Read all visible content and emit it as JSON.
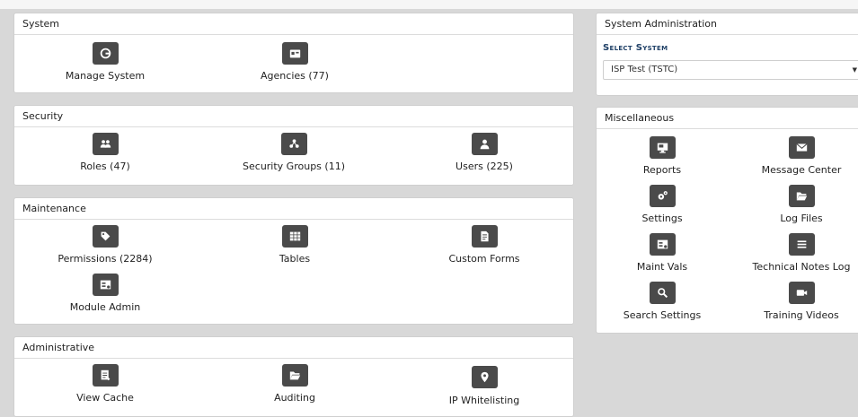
{
  "system": {
    "title": "System",
    "items": [
      {
        "label": "Manage System",
        "icon": "manage-system-icon"
      },
      {
        "label": "Agencies (77)",
        "icon": "agencies-icon"
      }
    ]
  },
  "security": {
    "title": "Security",
    "items": [
      {
        "label": "Roles (47)",
        "icon": "roles-icon"
      },
      {
        "label": "Security Groups (11)",
        "icon": "security-groups-icon"
      },
      {
        "label": "Users (225)",
        "icon": "user-icon"
      }
    ]
  },
  "maintenance": {
    "title": "Maintenance",
    "items": [
      {
        "label": "Permissions (2284)",
        "icon": "permissions-icon"
      },
      {
        "label": "Tables",
        "icon": "table-icon"
      },
      {
        "label": "Custom Forms",
        "icon": "custom-forms-icon"
      },
      {
        "label": "Module Admin",
        "icon": "module-admin-icon"
      }
    ]
  },
  "administrative": {
    "title": "Administrative",
    "items": [
      {
        "label": "View Cache",
        "icon": "view-cache-icon"
      },
      {
        "label": "Auditing",
        "icon": "folder-open-icon"
      },
      {
        "label": "IP Whitelisting",
        "icon": "ip-whitelisting-icon"
      }
    ]
  },
  "sysadmin": {
    "title": "System Administration",
    "select_label": "Select System",
    "selected_value": "ISP Test (TSTC)"
  },
  "misc": {
    "title": "Miscellaneous",
    "items": [
      {
        "label": "Reports",
        "icon": "reports-icon"
      },
      {
        "label": "Message Center",
        "icon": "envelope-icon"
      },
      {
        "label": "Settings",
        "icon": "cogs-icon"
      },
      {
        "label": "Log Files",
        "icon": "folder-open-icon"
      },
      {
        "label": "Maint Vals",
        "icon": "maint-vals-icon"
      },
      {
        "label": "Technical Notes Log",
        "icon": "list-icon"
      },
      {
        "label": "Search Settings",
        "icon": "search-icon"
      },
      {
        "label": "Training Videos",
        "icon": "video-camera-icon"
      }
    ]
  },
  "colors": {
    "background": "#d8d8d8",
    "panel": "#ffffff",
    "icon_button": "#4a4a4a",
    "select_title": "#1e3f66"
  }
}
